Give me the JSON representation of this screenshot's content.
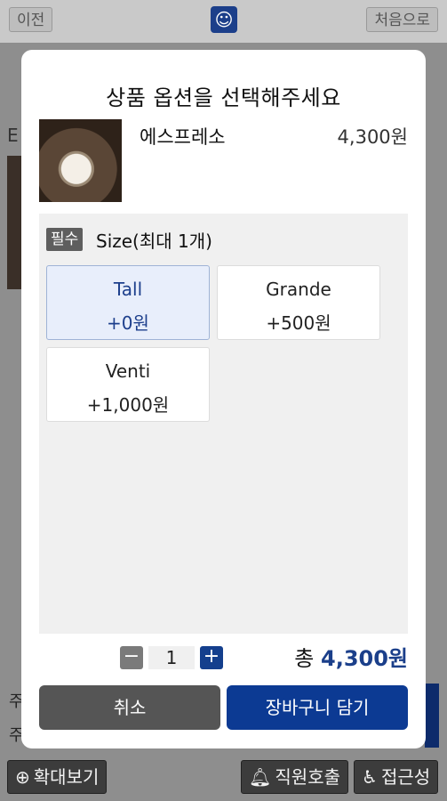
{
  "topbar": {
    "prev_label": "이전",
    "home_label": "처음으로"
  },
  "background": {
    "left_text": "E",
    "bottom_lines": [
      "주",
      "주"
    ]
  },
  "bottombar": {
    "zoom_label": "확대보기",
    "call_label": "직원호출",
    "access_label": "접근성"
  },
  "modal": {
    "title": "상품 옵션을 선택해주세요",
    "product": {
      "name": "에스프레소",
      "price": "4,300원"
    },
    "option_group": {
      "badge": "필수",
      "title": "Size(최대 1개)",
      "options": [
        {
          "name": "Tall",
          "add": "+0원",
          "selected": true
        },
        {
          "name": "Grande",
          "add": "+500원",
          "selected": false
        },
        {
          "name": "Venti",
          "add": "+1,000원",
          "selected": false
        }
      ]
    },
    "quantity": {
      "minus": "−",
      "value": "1",
      "plus": "+"
    },
    "total": {
      "prefix": "총",
      "amount": "4,300원"
    },
    "buttons": {
      "cancel": "취소",
      "add_to_cart": "장바구니 담기"
    }
  },
  "colors": {
    "accent": "#0c3a93",
    "selected_bg": "#e8eefb",
    "cancel_bg": "#555555"
  }
}
